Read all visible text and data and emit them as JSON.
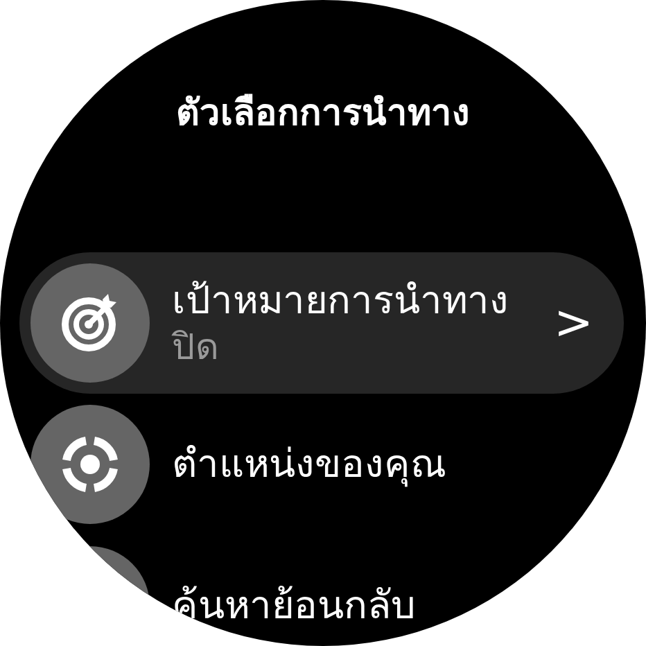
{
  "title": "ตัวเลือกการนำทาง",
  "items": [
    {
      "label": "เป้าหมายการนำทาง",
      "subtitle": "ปิด",
      "chevron": ">",
      "selected": true
    },
    {
      "label": "ตำแหน่งของคุณ",
      "selected": false
    },
    {
      "label": "ค้นหาย้อนกลับ",
      "selected": false
    }
  ]
}
